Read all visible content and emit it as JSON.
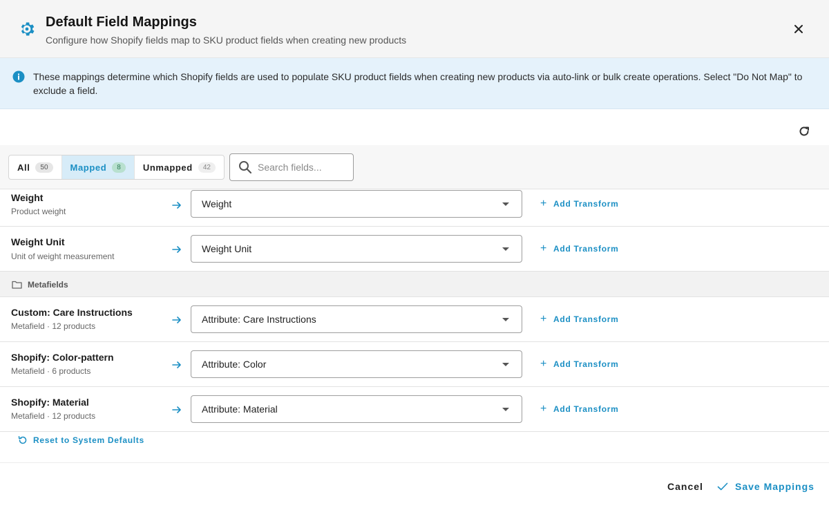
{
  "header": {
    "title": "Default Field Mappings",
    "subtitle": "Configure how Shopify fields map to SKU product fields when creating new products"
  },
  "info": {
    "text": "These mappings determine which Shopify fields are used to populate SKU product fields when creating new products via auto-link or bulk create operations. Select \"Do Not Map\" to exclude a field."
  },
  "filters": {
    "all": {
      "label": "All",
      "count": "50"
    },
    "mapped": {
      "label": "Mapped",
      "count": "8"
    },
    "unmapped": {
      "label": "Unmapped",
      "count": "42"
    }
  },
  "search": {
    "placeholder": "Search fields...",
    "value": ""
  },
  "rows": [
    {
      "name": "Weight",
      "desc": "Product weight",
      "value": "Weight",
      "action": "Add Transform"
    },
    {
      "name": "Weight Unit",
      "desc": "Unit of weight measurement",
      "value": "Weight Unit",
      "action": "Add Transform"
    }
  ],
  "group": {
    "label": "Metafields"
  },
  "meta_rows": [
    {
      "name": "Custom: Care Instructions",
      "desc": "Metafield · 12 products",
      "value": "Attribute: Care Instructions",
      "action": "Add Transform"
    },
    {
      "name": "Shopify: Color-pattern",
      "desc": "Metafield · 6 products",
      "value": "Attribute: Color",
      "action": "Add Transform"
    },
    {
      "name": "Shopify: Material",
      "desc": "Metafield · 12 products",
      "value": "Attribute: Material",
      "action": "Add Transform"
    }
  ],
  "reset_label": "Reset to System Defaults",
  "footer": {
    "cancel": "Cancel",
    "save": "Save Mappings"
  },
  "colors": {
    "accent": "#1b8fc4",
    "info_bg": "#e5f2fb",
    "mapped_bg": "#d7ecf8"
  }
}
